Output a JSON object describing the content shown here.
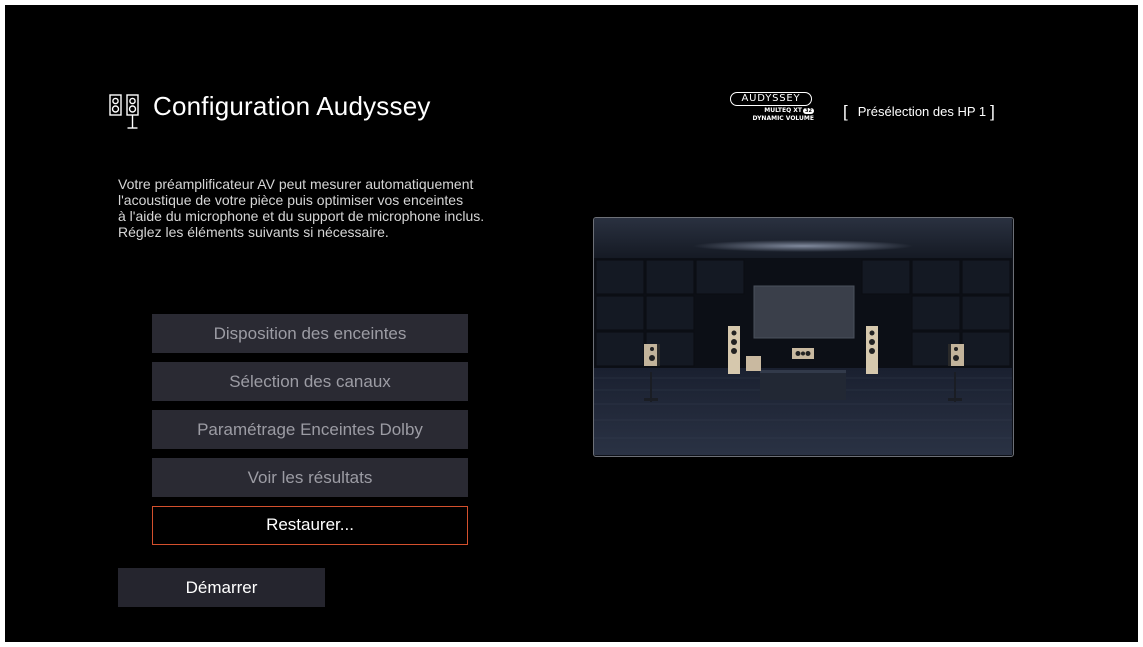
{
  "header": {
    "title": "Configuration Audyssey",
    "brand": {
      "logo_text": "AUDYSSEY",
      "line1": "MULTEQ XT",
      "line1_badge": "32",
      "line2": "DYNAMIC VOLUME"
    },
    "preset": "Présélection des HP 1"
  },
  "description": [
    "Votre préamplificateur AV peut mesurer automatiquement",
    "l'acoustique de votre pièce puis optimiser vos enceintes",
    "à l'aide du microphone et du support de microphone inclus.",
    "Réglez les éléments suivants si nécessaire."
  ],
  "menu": {
    "items": [
      {
        "label": "Disposition des enceintes",
        "selected": false
      },
      {
        "label": "Sélection des canaux",
        "selected": false
      },
      {
        "label": "Paramétrage Enceintes Dolby",
        "selected": false
      },
      {
        "label": "Voir les résultats",
        "selected": false
      },
      {
        "label": "Restaurer...",
        "selected": true
      }
    ],
    "start_label": "Démarrer"
  },
  "icons": {
    "title": "speakers-icon"
  },
  "colors": {
    "background": "#000000",
    "menu_item": "#2a2a33",
    "menu_text": "#9c9ca4",
    "selection_border": "#d4502d",
    "text": "#ffffff"
  }
}
